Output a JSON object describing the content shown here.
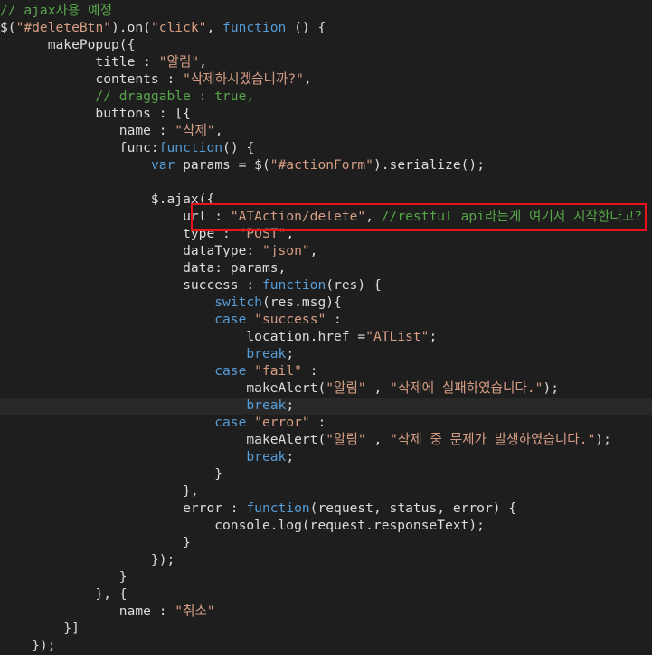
{
  "editor": {
    "highlight_color": "#e8141b",
    "colors": {
      "background": "#1e1e1e",
      "default_text": "#d4d4d4",
      "comment": "#57a64a",
      "string": "#d69d85",
      "keyword": "#569cd6"
    },
    "lines": [
      [
        {
          "t": "// ajax사용 예정",
          "c": "cmt"
        }
      ],
      [
        {
          "t": "$(",
          "c": "pl"
        },
        {
          "t": "\"#deleteBtn\"",
          "c": "str"
        },
        {
          "t": ").on(",
          "c": "pl"
        },
        {
          "t": "\"click\"",
          "c": "str"
        },
        {
          "t": ", ",
          "c": "pl"
        },
        {
          "t": "function",
          "c": "kw"
        },
        {
          "t": " () {",
          "c": "pl"
        }
      ],
      [
        {
          "t": "      makePopup({",
          "c": "pl"
        }
      ],
      [
        {
          "t": "            title : ",
          "c": "pl"
        },
        {
          "t": "\"알림\"",
          "c": "str"
        },
        {
          "t": ",",
          "c": "pl"
        }
      ],
      [
        {
          "t": "            contents : ",
          "c": "pl"
        },
        {
          "t": "\"삭제하시겠습니까?\"",
          "c": "str"
        },
        {
          "t": ",",
          "c": "pl"
        }
      ],
      [
        {
          "t": "            // draggable : true,",
          "c": "cmt"
        }
      ],
      [
        {
          "t": "            buttons : [{",
          "c": "pl"
        }
      ],
      [
        {
          "t": "               name : ",
          "c": "pl"
        },
        {
          "t": "\"삭제\"",
          "c": "str"
        },
        {
          "t": ",",
          "c": "pl"
        }
      ],
      [
        {
          "t": "               func:",
          "c": "pl"
        },
        {
          "t": "function",
          "c": "kw"
        },
        {
          "t": "() {",
          "c": "pl"
        }
      ],
      [
        {
          "t": "                   ",
          "c": "pl"
        },
        {
          "t": "var",
          "c": "kw"
        },
        {
          "t": " params = $(",
          "c": "pl"
        },
        {
          "t": "\"#actionForm\"",
          "c": "str"
        },
        {
          "t": ").serialize();",
          "c": "pl"
        }
      ],
      [],
      [
        {
          "t": "                   $.ajax({",
          "c": "pl"
        }
      ],
      [
        {
          "t": "                       url : ",
          "c": "pl"
        },
        {
          "t": "\"ATAction/delete\"",
          "c": "str"
        },
        {
          "t": ", ",
          "c": "pl"
        },
        {
          "t": "//restful api라는게 여기서 시작한다고?",
          "c": "cmt"
        }
      ],
      [
        {
          "t": "                       type : ",
          "c": "pl"
        },
        {
          "t": "\"POST\"",
          "c": "str"
        },
        {
          "t": ",",
          "c": "pl"
        }
      ],
      [
        {
          "t": "                       dataType: ",
          "c": "pl"
        },
        {
          "t": "\"json\"",
          "c": "str"
        },
        {
          "t": ",",
          "c": "pl"
        }
      ],
      [
        {
          "t": "                       data: params,",
          "c": "pl"
        }
      ],
      [
        {
          "t": "                       success : ",
          "c": "pl"
        },
        {
          "t": "function",
          "c": "kw"
        },
        {
          "t": "(res) {",
          "c": "pl"
        }
      ],
      [
        {
          "t": "                           ",
          "c": "pl"
        },
        {
          "t": "switch",
          "c": "kw"
        },
        {
          "t": "(res.msg){",
          "c": "pl"
        }
      ],
      [
        {
          "t": "                           ",
          "c": "pl"
        },
        {
          "t": "case",
          "c": "kw"
        },
        {
          "t": " ",
          "c": "pl"
        },
        {
          "t": "\"success\"",
          "c": "str"
        },
        {
          "t": " :",
          "c": "pl"
        }
      ],
      [
        {
          "t": "                               location.href =",
          "c": "pl"
        },
        {
          "t": "\"ATList\"",
          "c": "str"
        },
        {
          "t": ";",
          "c": "pl"
        }
      ],
      [
        {
          "t": "                               ",
          "c": "pl"
        },
        {
          "t": "break",
          "c": "kw"
        },
        {
          "t": ";",
          "c": "pl"
        }
      ],
      [
        {
          "t": "                           ",
          "c": "pl"
        },
        {
          "t": "case",
          "c": "kw"
        },
        {
          "t": " ",
          "c": "pl"
        },
        {
          "t": "\"fail\"",
          "c": "str"
        },
        {
          "t": " :",
          "c": "pl"
        }
      ],
      [
        {
          "t": "                               makeAlert(",
          "c": "pl"
        },
        {
          "t": "\"알림\"",
          "c": "str"
        },
        {
          "t": " , ",
          "c": "pl"
        },
        {
          "t": "\"삭제에 실패하였습니다.\"",
          "c": "str"
        },
        {
          "t": ");",
          "c": "pl"
        }
      ],
      [
        {
          "t": "                               ",
          "c": "pl"
        },
        {
          "t": "break",
          "c": "kw"
        },
        {
          "t": ";",
          "c": "pl"
        }
      ],
      [
        {
          "t": "                           ",
          "c": "pl"
        },
        {
          "t": "case",
          "c": "kw"
        },
        {
          "t": " ",
          "c": "pl"
        },
        {
          "t": "\"error\"",
          "c": "str"
        },
        {
          "t": " :",
          "c": "pl"
        }
      ],
      [
        {
          "t": "                               makeAlert(",
          "c": "pl"
        },
        {
          "t": "\"알림\"",
          "c": "str"
        },
        {
          "t": " , ",
          "c": "pl"
        },
        {
          "t": "\"삭제 중 문제가 발생하였습니다.\"",
          "c": "str"
        },
        {
          "t": ");",
          "c": "pl"
        }
      ],
      [
        {
          "t": "                               ",
          "c": "pl"
        },
        {
          "t": "break",
          "c": "kw"
        },
        {
          "t": ";",
          "c": "pl"
        }
      ],
      [
        {
          "t": "                           }",
          "c": "pl"
        }
      ],
      [
        {
          "t": "                       },",
          "c": "pl"
        }
      ],
      [
        {
          "t": "                       error : ",
          "c": "pl"
        },
        {
          "t": "function",
          "c": "kw"
        },
        {
          "t": "(request, status, error) {",
          "c": "pl"
        }
      ],
      [
        {
          "t": "                           console.log(request.responseText);",
          "c": "pl"
        }
      ],
      [
        {
          "t": "                       }",
          "c": "pl"
        }
      ],
      [
        {
          "t": "                   });",
          "c": "pl"
        }
      ],
      [
        {
          "t": "               }",
          "c": "pl"
        }
      ],
      [
        {
          "t": "            }, {",
          "c": "pl"
        }
      ],
      [
        {
          "t": "               name : ",
          "c": "pl"
        },
        {
          "t": "\"취소\"",
          "c": "str"
        }
      ],
      [
        {
          "t": "        }]",
          "c": "pl"
        }
      ],
      [
        {
          "t": "    });",
          "c": "pl"
        }
      ]
    ]
  }
}
